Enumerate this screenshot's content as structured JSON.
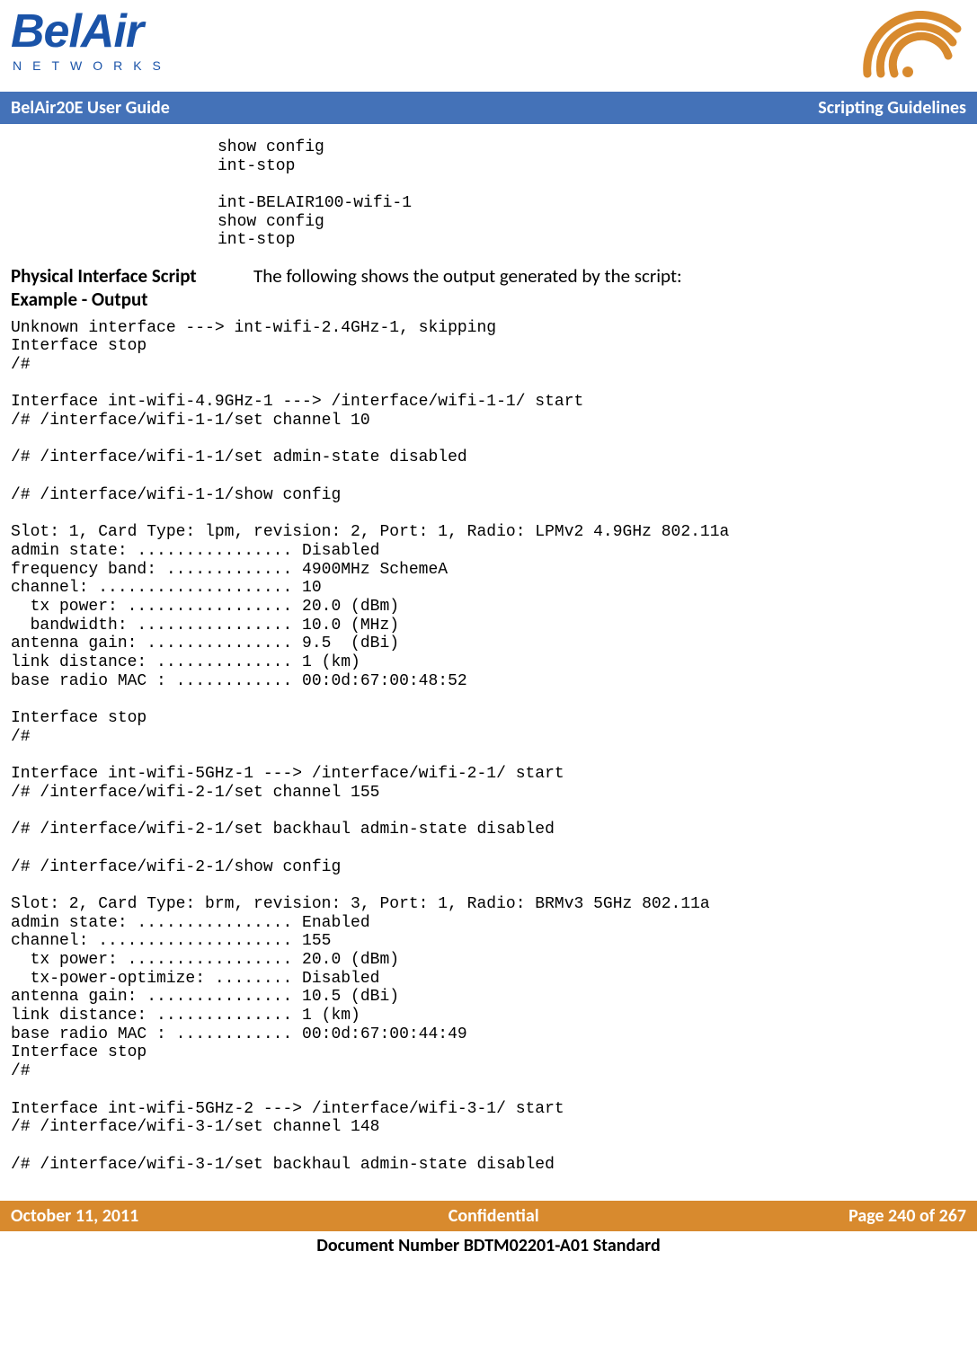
{
  "header": {
    "logo_main": "BelAir",
    "logo_sub": "NETWORKS"
  },
  "titlebar": {
    "left": "BelAir20E User Guide",
    "right": "Scripting Guidelines"
  },
  "code_top": "show config\nint-stop\n\nint-BELAIR100-wifi-1\nshow config\nint-stop",
  "section": {
    "heading": "Physical Interface Script Example - Output",
    "desc": "The following shows the output generated by the script:"
  },
  "code_main": "Unknown interface ---> int-wifi-2.4GHz-1, skipping\nInterface stop\n/#\n\nInterface int-wifi-4.9GHz-1 ---> /interface/wifi-1-1/ start\n/# /interface/wifi-1-1/set channel 10\n\n/# /interface/wifi-1-1/set admin-state disabled\n\n/# /interface/wifi-1-1/show config\n\nSlot: 1, Card Type: lpm, revision: 2, Port: 1, Radio: LPMv2 4.9GHz 802.11a\nadmin state: ................ Disabled\nfrequency band: ............. 4900MHz SchemeA\nchannel: .................... 10\n  tx power: ................. 20.0 (dBm)\n  bandwidth: ................ 10.0 (MHz)\nantenna gain: ............... 9.5  (dBi)\nlink distance: .............. 1 (km)\nbase radio MAC : ............ 00:0d:67:00:48:52\n\nInterface stop\n/#\n\nInterface int-wifi-5GHz-1 ---> /interface/wifi-2-1/ start\n/# /interface/wifi-2-1/set channel 155\n\n/# /interface/wifi-2-1/set backhaul admin-state disabled\n\n/# /interface/wifi-2-1/show config\n\nSlot: 2, Card Type: brm, revision: 3, Port: 1, Radio: BRMv3 5GHz 802.11a\nadmin state: ................ Enabled\nchannel: .................... 155\n  tx power: ................. 20.0 (dBm)\n  tx-power-optimize: ........ Disabled\nantenna gain: ............... 10.5 (dBi)\nlink distance: .............. 1 (km)\nbase radio MAC : ............ 00:0d:67:00:44:49\nInterface stop\n/#\n\nInterface int-wifi-5GHz-2 ---> /interface/wifi-3-1/ start\n/# /interface/wifi-3-1/set channel 148\n\n/# /interface/wifi-3-1/set backhaul admin-state disabled",
  "footer": {
    "left": "October 11, 2011",
    "center": "Confidential",
    "right": "Page 240 of 267",
    "doc": "Document Number BDTM02201-A01 Standard"
  }
}
